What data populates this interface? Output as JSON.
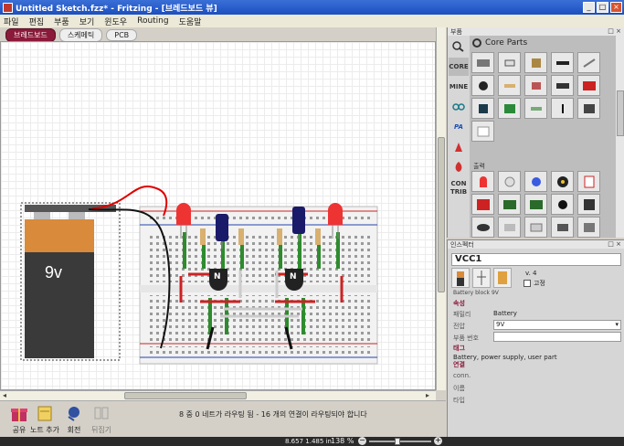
{
  "window": {
    "title": "Untitled Sketch.fzz* - Fritzing - [브레드보드 뷰]",
    "min": "_",
    "max": "□",
    "close": "×"
  },
  "menu": [
    "파일",
    "편집",
    "부품",
    "보기",
    "윈도우",
    "Routing",
    "도움말"
  ],
  "view_tabs": [
    {
      "label": "브레드보드",
      "active": true
    },
    {
      "label": "스케메틱",
      "active": false
    },
    {
      "label": "PCB",
      "active": false
    }
  ],
  "canvas": {
    "battery_label": "9v",
    "transistor_label": "N"
  },
  "toolbar": {
    "share_label": "공유",
    "add_note_label": "노트 추가",
    "rotate_label": "회전",
    "flip_label": "뒤집기",
    "status_message": "8 중 0 네트가 라우팅 됨 - 16 개의 연결이 라우팅되야 합니다"
  },
  "statusbar": {
    "coords": "8.657 1.485 in",
    "zoom": "138 %",
    "zoom_minus": "−",
    "zoom_plus": "+"
  },
  "parts_panel": {
    "header": "부품",
    "header_ctrls": "□ ×",
    "search_title": "Core Parts",
    "bins": [
      "CORE",
      "MINE",
      "PA",
      "CON TRIB"
    ],
    "section_label": "출력"
  },
  "inspector": {
    "header": "인스펙터",
    "header_ctrls": "□ ×",
    "title": "VCC1",
    "version": "v. 4",
    "lock_label": "고정",
    "description": "Battery block 9V",
    "properties_heading": "속성",
    "family_key": "패밀리",
    "family_value": "Battery",
    "voltage_key": "전압",
    "voltage_value": "9V",
    "part_number_key": "부품 번호",
    "tags_heading": "태그",
    "tags_value": "Battery, power supply, user part",
    "connections_heading": "연결",
    "conn_key": "conn.",
    "name_key": "이름",
    "type_key": "타입"
  },
  "colors": {
    "accent": "#8b1a3a",
    "titlebar": "#2a5fcc",
    "wire_red": "#e00000",
    "wire_black": "#111111",
    "wire_green": "#2e8b2e",
    "battery_orange": "#d98a3a",
    "battery_body": "#3a3a3a"
  }
}
